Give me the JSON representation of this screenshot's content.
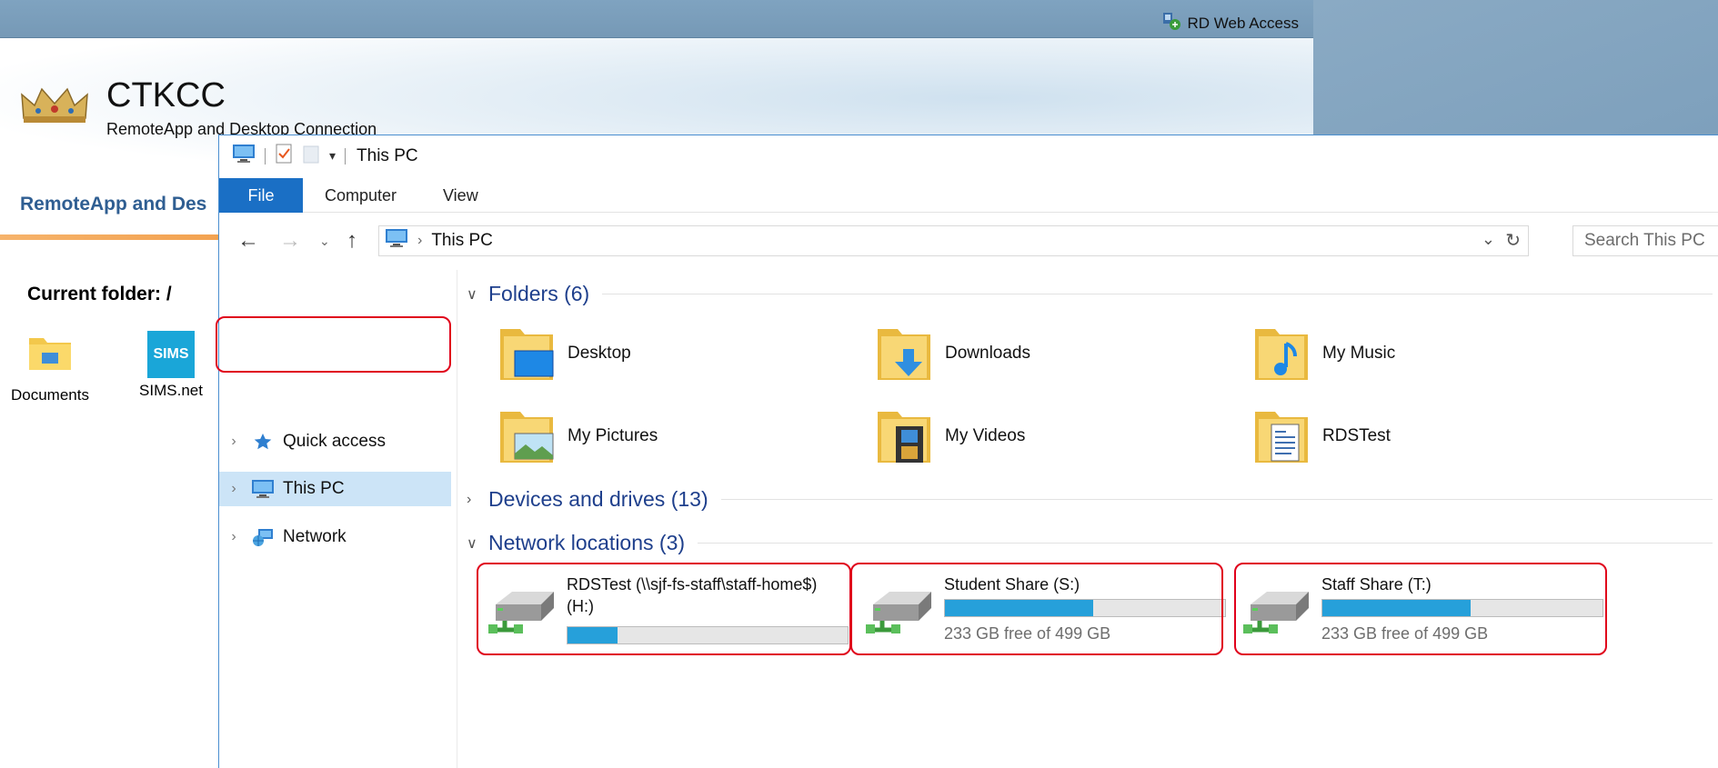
{
  "rdweb": {
    "topbar_title": "RD Web Access",
    "site_name": "CTKCC",
    "site_subtitle": "RemoteApp and Desktop Connection",
    "nav_title": "RemoteApp and Des",
    "current_folder": "Current folder: /",
    "apps": [
      {
        "label": "Documents"
      },
      {
        "label": "SIMS.net",
        "icon_text": "SIMS"
      }
    ]
  },
  "explorer": {
    "window_title": "This PC",
    "ribbon_tabs": [
      "File",
      "Computer",
      "View"
    ],
    "address": "This PC",
    "search_placeholder": "Search This PC",
    "nav": [
      {
        "label": "Quick access",
        "icon": "star-icon"
      },
      {
        "label": "This PC",
        "icon": "computer-icon",
        "selected": true
      },
      {
        "label": "Network",
        "icon": "network-icon"
      }
    ],
    "groups": {
      "folders": "Folders (6)",
      "devices": "Devices and drives (13)",
      "network": "Network locations (3)"
    },
    "folders": [
      {
        "name": "Desktop",
        "icon": "desktop-folder-icon"
      },
      {
        "name": "Downloads",
        "icon": "downloads-folder-icon"
      },
      {
        "name": "My Music",
        "icon": "music-folder-icon"
      },
      {
        "name": "My Pictures",
        "icon": "pictures-folder-icon"
      },
      {
        "name": "My Videos",
        "icon": "videos-folder-icon"
      },
      {
        "name": "RDSTest",
        "icon": "document-folder-icon"
      }
    ],
    "drives": [
      {
        "name": "RDSTest (\\\\sjf-fs-staff\\staff-home$)",
        "letter": "(H:)",
        "used_fraction": 0.18,
        "size": ""
      },
      {
        "name": "Student Share (S:)",
        "letter": "",
        "used_fraction": 0.53,
        "size": "233 GB free of 499 GB"
      },
      {
        "name": "Staff Share (T:)",
        "letter": "",
        "used_fraction": 0.53,
        "size": "233 GB free of 499 GB"
      }
    ],
    "colors": {
      "accent": "#1a6fc5",
      "drive_fill": "#26a0da",
      "highlight": "#e0001b"
    }
  }
}
